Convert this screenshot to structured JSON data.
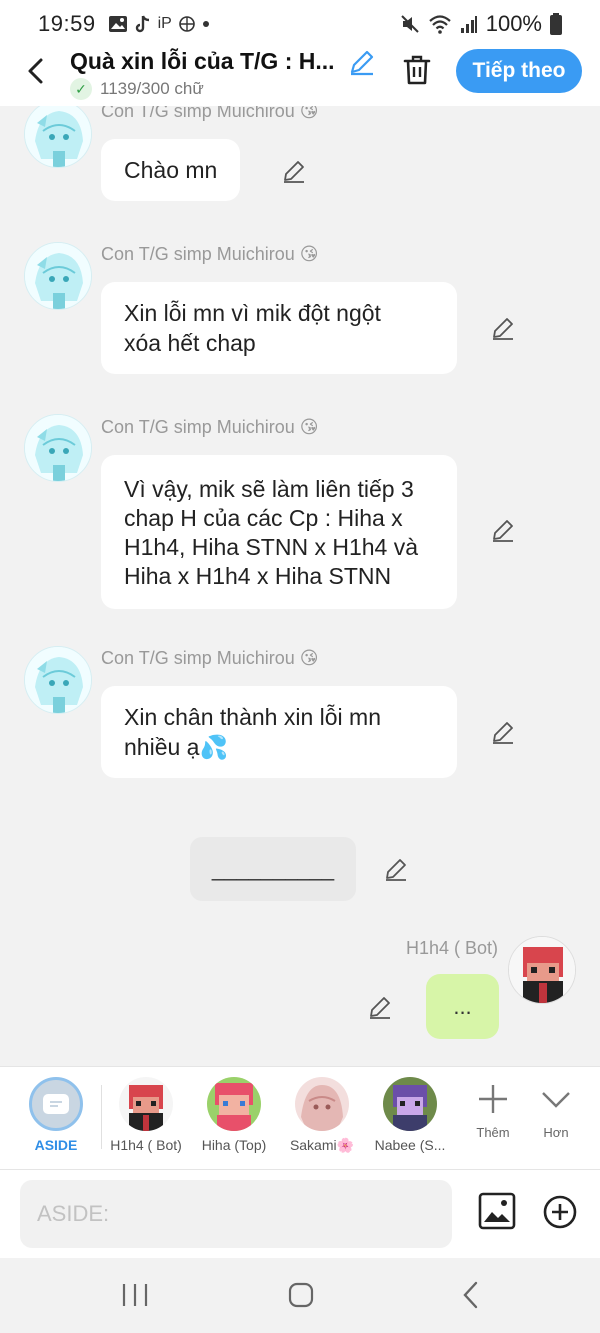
{
  "status_bar": {
    "time": "19:59",
    "battery": "100%",
    "notif_icons": [
      "gallery-icon",
      "tiktok-icon",
      "ip-icon",
      "pinwheel-icon",
      "dot-icon"
    ],
    "status_icons": [
      "mute-icon",
      "wifi-icon",
      "signal-icon",
      "battery-icon"
    ]
  },
  "header": {
    "title": "Quà xin lỗi của T/G : H...",
    "word_count": "1139/300 chữ",
    "next_label": "Tiếp theo"
  },
  "messages": [
    {
      "sender": "Con T/G simp Muichirou 😘",
      "lines": [
        "Chào mn"
      ]
    },
    {
      "sender": "Con T/G simp Muichirou 😘",
      "lines": [
        "Xin lỗi mn vì mik đột ngột",
        "xóa hết chap"
      ]
    },
    {
      "sender": "Con T/G simp Muichirou 😘",
      "lines": [
        "Vì vậy, mik sẽ làm liên tiếp 3",
        "chap H của các Cp : Hiha x",
        "H1h4, Hiha STNN x H1h4 và",
        "Hiha x H1h4 x Hiha STNN"
      ]
    },
    {
      "sender": "Con T/G simp Muichirou 😘",
      "lines": [
        "Xin chân thành xin lỗi mn",
        "nhiều ạ💦"
      ]
    }
  ],
  "divider_text": "__________",
  "bot_message": {
    "sender": "H1h4 ( Bot)",
    "text": "..."
  },
  "characters": [
    {
      "label": "ASIDE"
    },
    {
      "label": "H1h4 ( Bot)"
    },
    {
      "label": "Hiha (Top)"
    },
    {
      "label": "Sakami🌸"
    },
    {
      "label": "Nabee (S..."
    }
  ],
  "tools": {
    "add_label": "Thêm",
    "more_label": "Hơn"
  },
  "composer": {
    "placeholder": "ASIDE:"
  },
  "colors": {
    "accent": "#3a9bf3",
    "bot_bubble": "#d7f5a8",
    "background": "#f2f2f2"
  }
}
